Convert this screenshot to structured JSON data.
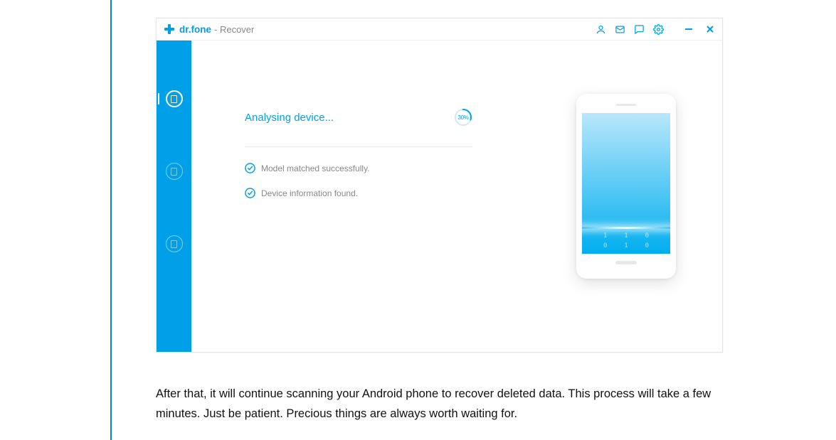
{
  "app": {
    "brand": "dr.fone",
    "section": " - Recover"
  },
  "analysis": {
    "title": "Analysing device...",
    "progress_percent": 30,
    "progress_label": "30%"
  },
  "steps": [
    {
      "text": "Model matched successfully."
    },
    {
      "text": "Device information found."
    }
  ],
  "phone": {
    "row1": {
      "a": "1",
      "b": "1",
      "c": "0"
    },
    "row2": {
      "a": "0",
      "b": "1",
      "c": "0"
    }
  },
  "paragraph": "After that, it will continue scanning your Android phone to recover deleted data. This process will take a few minutes. Just be patient. Precious things are always worth waiting for."
}
